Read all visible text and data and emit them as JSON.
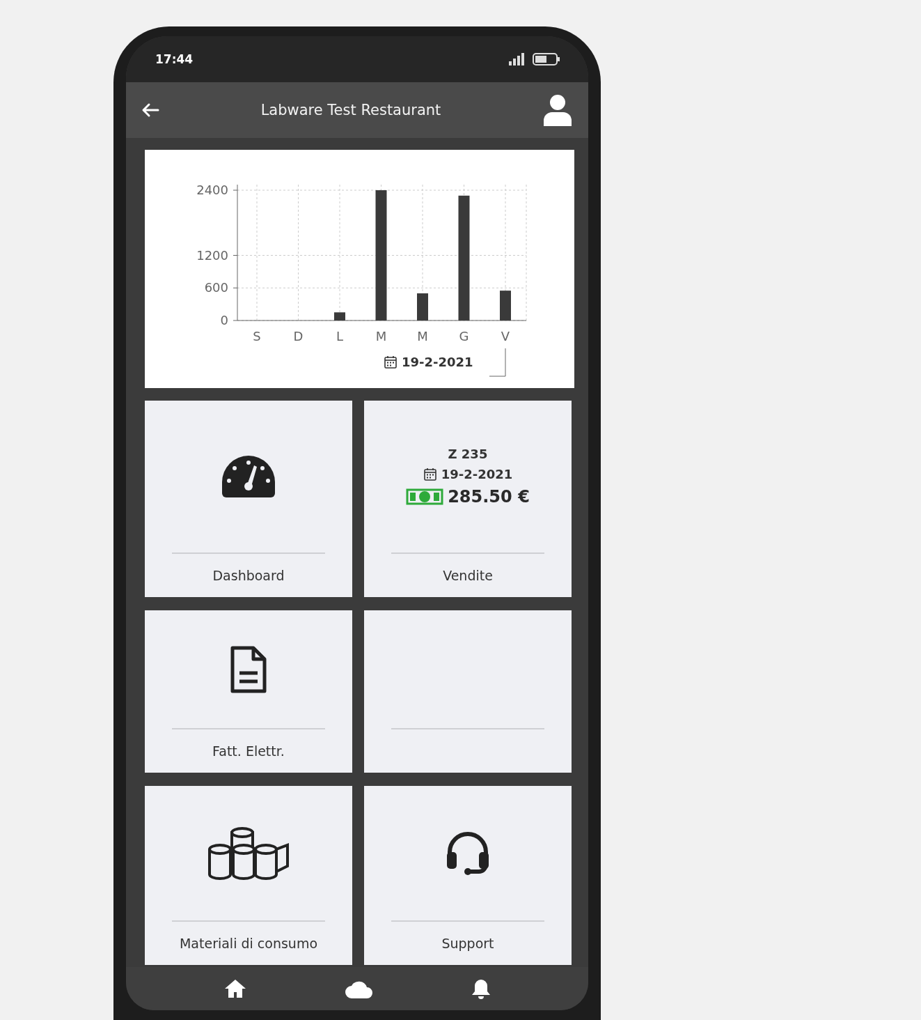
{
  "status_bar": {
    "time": "17:44"
  },
  "app_bar": {
    "title": "Labware Test Restaurant"
  },
  "chart": {
    "date": "19-2-2021",
    "chart_data": {
      "type": "bar",
      "categories": [
        "S",
        "D",
        "L",
        "M",
        "M",
        "G",
        "V"
      ],
      "series": [
        {
          "color": "#3a3a3a",
          "values": [
            0,
            0,
            150,
            2400,
            500,
            2300,
            550
          ]
        }
      ],
      "ylim": [
        0,
        2400
      ],
      "yticks": [
        0,
        600,
        1200,
        2400
      ],
      "grid": true
    }
  },
  "tiles": [
    {
      "kind": "gauge",
      "label": "Dashboard"
    },
    {
      "kind": "sales",
      "label": "Vendite",
      "number": "Z 235",
      "date": "19-2-2021",
      "amount": "285.50 €"
    },
    {
      "kind": "document",
      "label": "Fatt. Elettr."
    },
    {
      "kind": "empty"
    },
    {
      "kind": "rolls",
      "label": "Materiali di consumo"
    },
    {
      "kind": "headset",
      "label": "Support"
    }
  ]
}
